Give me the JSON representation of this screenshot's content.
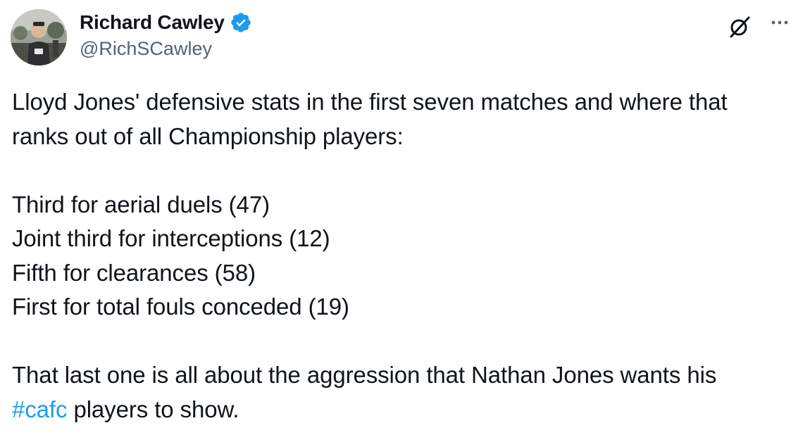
{
  "author": {
    "display_name": "Richard Cawley",
    "handle": "@RichSCawley",
    "verified": true,
    "avatar_icon": "profile-photo"
  },
  "actions": {
    "grok_icon": "grok-slash-icon",
    "more_icon": "more-horizontal-icon"
  },
  "tweet": {
    "intro_line_1": "Lloyd Jones' defensive stats in the first seven matches and where that",
    "intro_line_2": "ranks out of all Championship players:",
    "stats": [
      "Third for aerial duels (47)",
      "Joint third for interceptions (12)",
      "Fifth for clearances (58)",
      "First for total fouls conceded (19)"
    ],
    "closing_line_1": "That last one is all about the aggression that Nathan Jones wants his",
    "hashtag": "#cafc",
    "closing_line_2_rest": " players to show."
  },
  "colors": {
    "text": "#0f1419",
    "secondary": "#536471",
    "link": "#1d9bf0",
    "verified_badge": "#1d9bf0"
  }
}
